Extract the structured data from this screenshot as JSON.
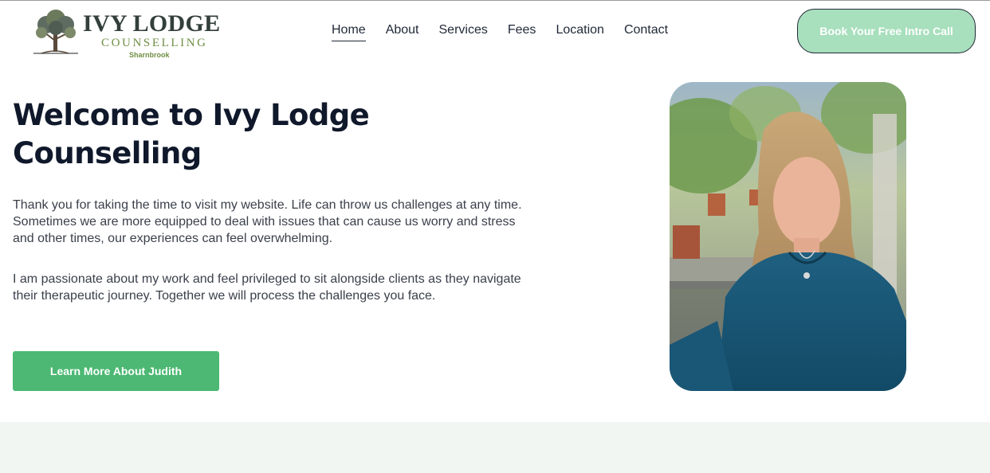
{
  "header": {
    "logo": {
      "title": "IVY LODGE",
      "subtitle": "COUNSELLING",
      "place": "Sharnbrook"
    },
    "nav": [
      {
        "label": "Home",
        "active": true
      },
      {
        "label": "About"
      },
      {
        "label": "Services"
      },
      {
        "label": "Fees"
      },
      {
        "label": "Location"
      },
      {
        "label": "Contact"
      }
    ],
    "cta_label": "Book Your Free Intro Call"
  },
  "hero": {
    "heading": "Welcome to Ivy Lodge Counselling",
    "paragraph_1": "Thank you for taking the time to visit my website. Life can throw us challenges at any time. Sometimes we are more equipped to deal with issues that can cause us worry and stress and other times, our experiences can feel overwhelming.",
    "paragraph_2": "I am passionate about my work and feel privileged to sit alongside clients as they navigate their therapeutic journey. Together we will process the challenges you face.",
    "button_label": "Learn More About Judith"
  },
  "colors": {
    "accent_green": "#4cb873",
    "cta_light_green": "#a8dfbd",
    "heading_navy": "#10192b",
    "logo_olive": "#6f8f44",
    "band_bg": "#f2f6f3"
  }
}
